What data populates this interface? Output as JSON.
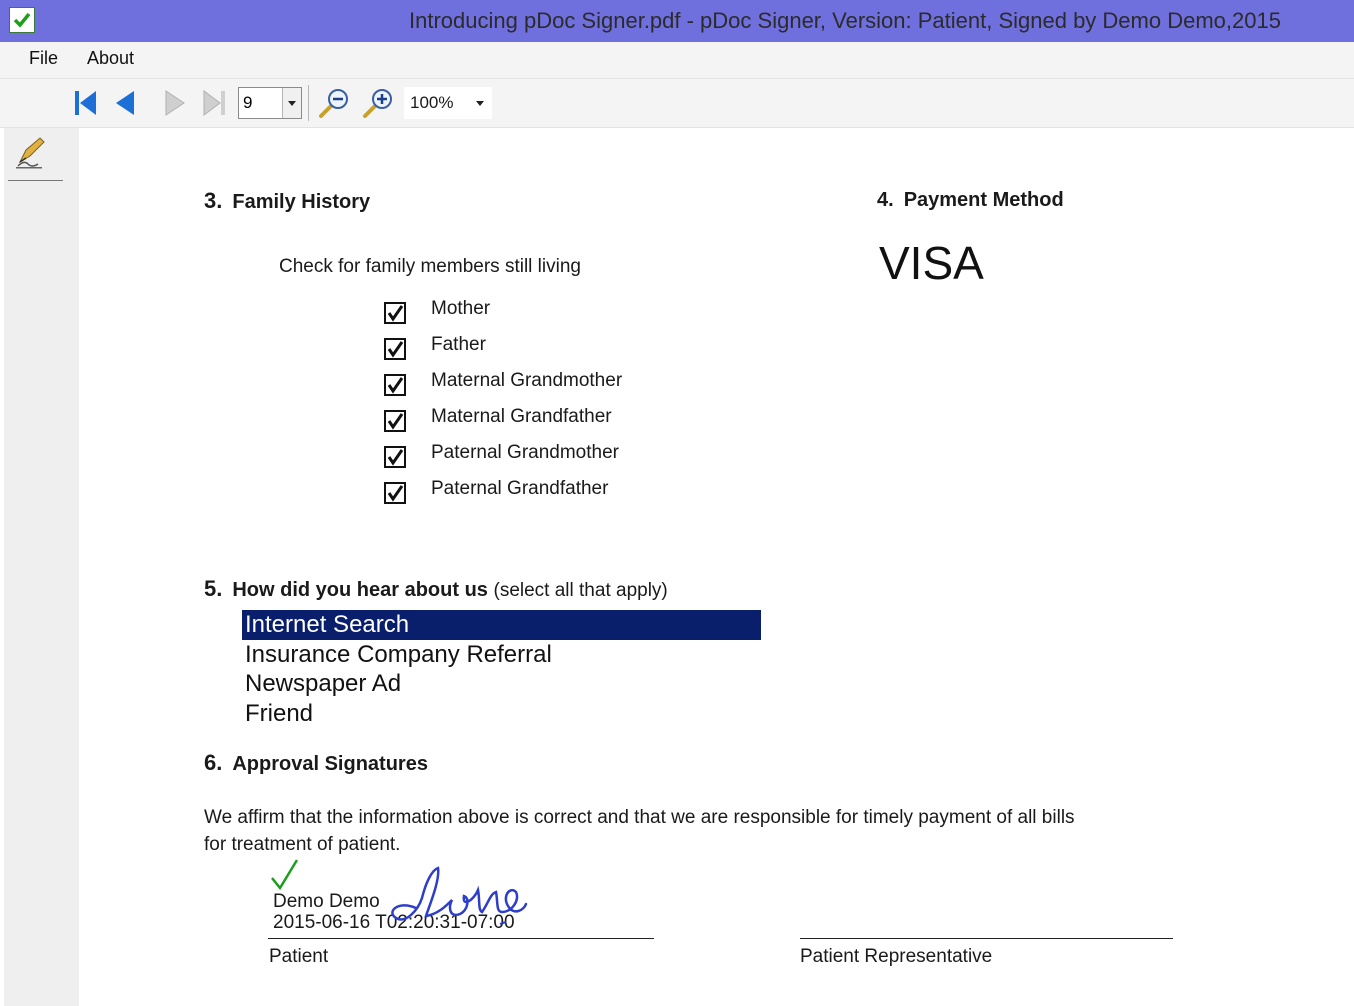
{
  "window": {
    "title": "Introducing pDoc Signer.pdf - pDoc Signer,  Version:  Patient, Signed by   Demo Demo,2015",
    "app_icon": "green-check-icon"
  },
  "menu": {
    "file": "File",
    "about": "About"
  },
  "toolbar": {
    "first_page_icon": "first-page-icon",
    "prev_page_icon": "prev-page-icon",
    "next_page_icon": "next-page-icon",
    "last_page_icon": "last-page-icon",
    "page_number": "9",
    "zoom_out_icon": "zoom-out-icon",
    "zoom_in_icon": "zoom-in-icon",
    "zoom_level": "100%"
  },
  "sidebar": {
    "sign_tool_icon": "pen-sign-icon"
  },
  "document": {
    "family_history": {
      "number": "3.",
      "title": "Family History",
      "instruction": "Check for family members still living",
      "members": [
        {
          "label": "Mother",
          "checked": true
        },
        {
          "label": "Father",
          "checked": true
        },
        {
          "label": "Maternal Grandmother",
          "checked": true
        },
        {
          "label": "Maternal Grandfather",
          "checked": true
        },
        {
          "label": "Paternal Grandmother",
          "checked": true
        },
        {
          "label": "Paternal Grandfather",
          "checked": true
        }
      ]
    },
    "payment": {
      "number": "4.",
      "title": "Payment Method",
      "value": "VISA"
    },
    "referral": {
      "number": "5.",
      "title": "How did you hear about us",
      "subtitle": "(select all that apply)",
      "options": [
        {
          "label": "Internet Search",
          "selected": true
        },
        {
          "label": "Insurance Company Referral",
          "selected": false
        },
        {
          "label": "Newspaper Ad",
          "selected": false
        },
        {
          "label": "Friend",
          "selected": false
        }
      ]
    },
    "approval": {
      "number": "6.",
      "title": "Approval Signatures",
      "statement_line1": "We affirm that the information above is correct and that we are responsible for timely payment of all bills",
      "statement_line2": "for treatment of patient.",
      "signer_name": "Demo Demo",
      "signed_timestamp": "2015-06-16 T02:20:31-07:00",
      "handwritten_signature": "demo",
      "patient_label": "Patient",
      "representative_label": "Patient Representative"
    }
  },
  "colors": {
    "titlebar": "#6f6fde",
    "selected_list_item": "#0a1f6b",
    "signature_ink": "#2d3ec9",
    "check_green": "#1e9e1e",
    "nav_blue": "#1c6fd6"
  }
}
